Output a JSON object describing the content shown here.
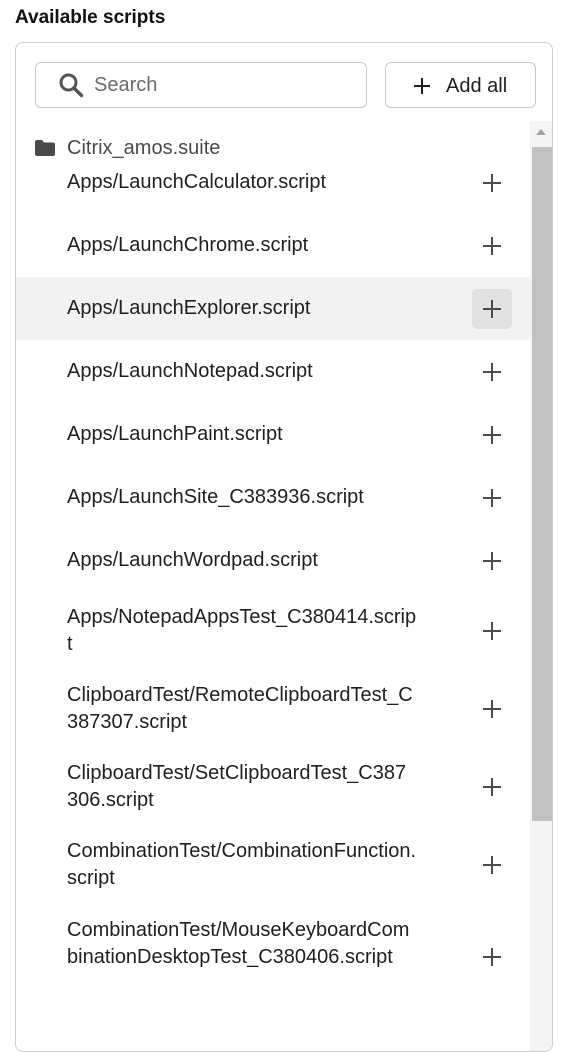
{
  "heading": "Available scripts",
  "search": {
    "placeholder": "Search",
    "value": ""
  },
  "add_all": {
    "label": "Add all"
  },
  "folder": {
    "icon": "folder-icon",
    "label": "Citrix_amos.suite"
  },
  "scripts": [
    {
      "label": "Apps/LaunchCalculator.script"
    },
    {
      "label": "Apps/LaunchChrome.script"
    },
    {
      "label": "Apps/LaunchExplorer.script",
      "hovered": true
    },
    {
      "label": "Apps/LaunchNotepad.script"
    },
    {
      "label": "Apps/LaunchPaint.script"
    },
    {
      "label": "Apps/LaunchSite_C383936.script"
    },
    {
      "label": "Apps/LaunchWordpad.script"
    },
    {
      "label": "Apps/NotepadAppsTest_C380414.script"
    },
    {
      "label": "ClipboardTest/RemoteClipboardTest_C387307.script"
    },
    {
      "label": "ClipboardTest/SetClipboardTest_C387306.script"
    },
    {
      "label": "CombinationTest/CombinationFunction.script"
    },
    {
      "label": "CombinationTest/MouseKeyboardCombinationDesktopTest_C380406.script"
    }
  ],
  "colors": {
    "text": "#1f1f1f",
    "muted": "#4a4a4a",
    "hover_row": "#f2f2f2",
    "hover_button": "#e1e1e1",
    "border": "#cfcfcf",
    "scroll_thumb": "#c1c1c1"
  }
}
